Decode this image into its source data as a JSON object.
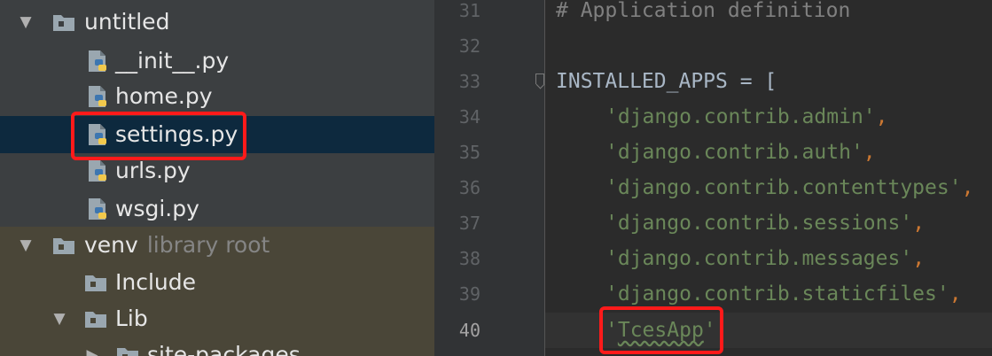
{
  "project_tree": {
    "items": [
      {
        "label": "untitled",
        "hint": ""
      },
      {
        "label": "__init__.py",
        "hint": ""
      },
      {
        "label": "home.py",
        "hint": ""
      },
      {
        "label": "settings.py",
        "hint": ""
      },
      {
        "label": "urls.py",
        "hint": ""
      },
      {
        "label": "wsgi.py",
        "hint": ""
      },
      {
        "label": "venv",
        "hint": "library root"
      },
      {
        "label": "Include",
        "hint": ""
      },
      {
        "label": "Lib",
        "hint": ""
      },
      {
        "label": "site-packages",
        "hint": ""
      }
    ]
  },
  "editor": {
    "line_numbers": [
      "31",
      "32",
      "33",
      "34",
      "35",
      "36",
      "37",
      "38",
      "39",
      "40"
    ],
    "comment": "# Application definition",
    "installed_apps_open": "INSTALLED_APPS = [",
    "apps": [
      "'django.contrib.admin'",
      "'django.contrib.auth'",
      "'django.contrib.contenttypes'",
      "'django.contrib.sessions'",
      "'django.contrib.messages'",
      "'django.contrib.staticfiles'"
    ],
    "comma": ",",
    "new_app_quote": "'",
    "new_app_name": "TcesApp"
  },
  "colors": {
    "highlight_box": "#ff1a1a",
    "selection": "#0d293e",
    "string": "#6a8759",
    "keyword_comma": "#cc7832"
  }
}
